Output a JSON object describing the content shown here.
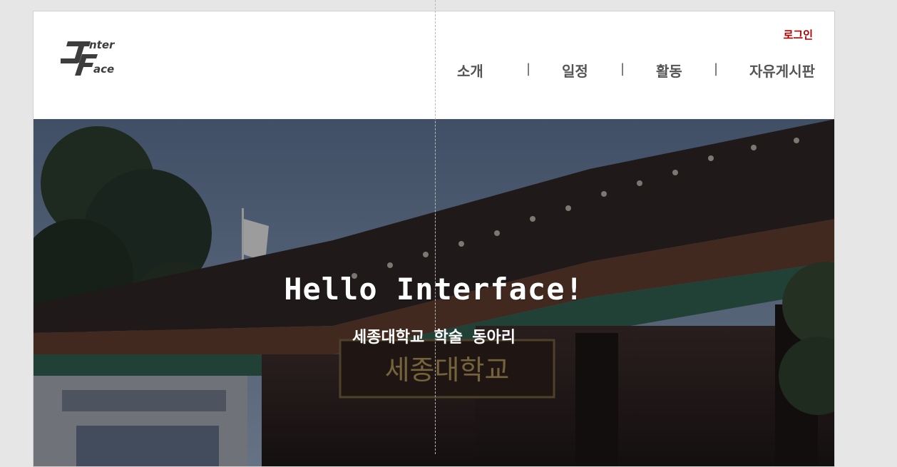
{
  "header": {
    "logo_text_top": "nter",
    "logo_text_bottom": "ace",
    "login_label": "로그인",
    "login_color": "#b00000"
  },
  "nav": {
    "items": [
      {
        "label": "소개"
      },
      {
        "label": "일정"
      },
      {
        "label": "활동"
      },
      {
        "label": "자유게시판"
      }
    ],
    "separator": "|"
  },
  "hero": {
    "title": "Hello Interface!",
    "subtitle": "세종대학교 학술 동아리",
    "signboard_text": "세종대학교"
  }
}
